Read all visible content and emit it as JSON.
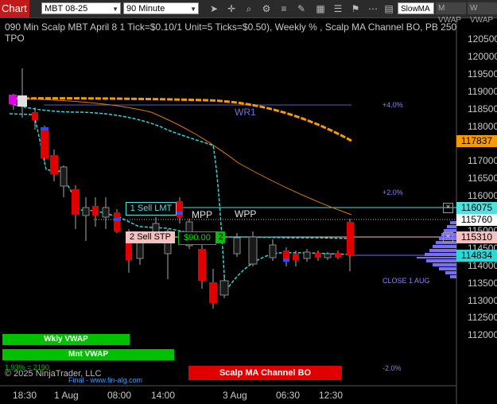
{
  "toolbar": {
    "tab_label": "Chart",
    "instrument": "MBT 08-25",
    "timeframe": "90 Minute",
    "icons": [
      "cursor-icon",
      "crosshair-icon",
      "zoom-icon",
      "gear-icon",
      "lines-icon",
      "draw-icon",
      "template-icon",
      "properties-icon",
      "strategy-icon",
      "more-icon",
      "grid-icon"
    ],
    "indicator_buttons": [
      "SlowMA",
      "M VWAP",
      "W VWAP"
    ]
  },
  "chart": {
    "title_line1": "090 Min Scalp MBT April 8 1 Tick=$0.10/1 Unit=5 Ticks=$0.50), Weekly % , Scalp MA Channel BO, PB 250p, Wk",
    "title_line2": "TPO",
    "copyright": "© 2025 NinjaTrader, LLC",
    "watermark": "Final - www.fin-alg.com",
    "stat_text": "1.93% = 2190",
    "buttons": {
      "weekly_vwap": "Wkly VWAP",
      "month_vwap": "Mnt VWAP",
      "scalp_bo": "Scalp MA Channel BO"
    },
    "price_axis": [
      "120500",
      "120000",
      "119500",
      "119000",
      "118500",
      "118000",
      "117500",
      "117000",
      "116500",
      "116000",
      "115500",
      "115000",
      "114500",
      "114000",
      "113500",
      "113000",
      "112500",
      "112000"
    ],
    "price_badges": {
      "slow_ma": "117837",
      "limit": "116075",
      "last": "115760",
      "stop": "115310",
      "vwap": "114834"
    },
    "time_axis": [
      "18:30",
      "1 Aug",
      "08:00",
      "14:00",
      "3 Aug",
      "06:30",
      "12:30"
    ],
    "percent_labels": {
      "plus4": "+4.0%",
      "plus2": "+2.0%",
      "minus2": "-2.0%"
    },
    "annotations": {
      "wr1": "WR1",
      "wpp": "WPP",
      "mpp": "MPP",
      "close": "CLOSE 1 AUG"
    },
    "orders": {
      "limit_label": "1 Sell LMT",
      "stop_label": "2 Sell STP",
      "pnl": "$90.00",
      "qty": "2",
      "close_x": "×"
    },
    "colors": {
      "bearish": "#e00000",
      "bullish": "#1a1a1a",
      "slow_ma": "#f59a00",
      "vwap": "#2ad8d8",
      "wr1_line": "#5a5ac8",
      "order_limit": "#4fe0e0",
      "order_stop": "#f5c0c0",
      "pnl_green": "#00c000"
    }
  }
}
